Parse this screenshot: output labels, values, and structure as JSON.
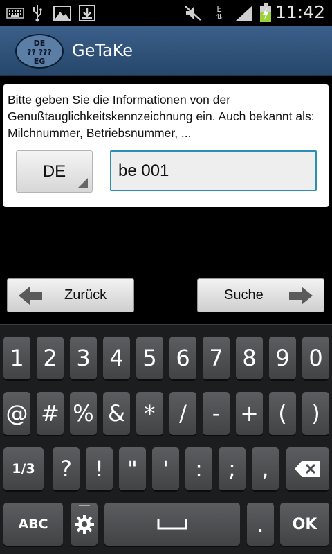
{
  "status_bar": {
    "time": "11:42",
    "network_label": "E",
    "left_icons": [
      "keyboard-icon",
      "usb-icon",
      "image-icon",
      "download-icon"
    ],
    "right_icons": [
      "mute-icon",
      "data-transfer-icon",
      "signal-icon",
      "battery-charging-icon"
    ]
  },
  "app": {
    "logo_lines": [
      "DE",
      "?? ???",
      "EG"
    ],
    "title": "GeTaKe"
  },
  "form": {
    "info_text": "Bitte geben Sie die Informationen von der Genußtauglichkeitskennzeichnung ein. Auch bekannt als: Milchnummer, Betriebsnummer, ...",
    "country_value": "DE",
    "code_value": "be 001"
  },
  "nav": {
    "back_label": "Zurück",
    "search_label": "Suche"
  },
  "keyboard": {
    "row1": [
      "1",
      "2",
      "3",
      "4",
      "5",
      "6",
      "7",
      "8",
      "9",
      "0"
    ],
    "row2": [
      "@",
      "#",
      "%",
      "&",
      "*",
      "/",
      "-",
      "+",
      "(",
      ")"
    ],
    "row3": [
      "1/3",
      "?",
      "!",
      "\"",
      "'",
      ":",
      ";",
      ","
    ],
    "row4": [
      "ABC",
      ".",
      "OK"
    ]
  },
  "colors": {
    "title_bar": "#2f5079",
    "input_focus": "#2b8fb4",
    "key": "#4d4f52"
  }
}
